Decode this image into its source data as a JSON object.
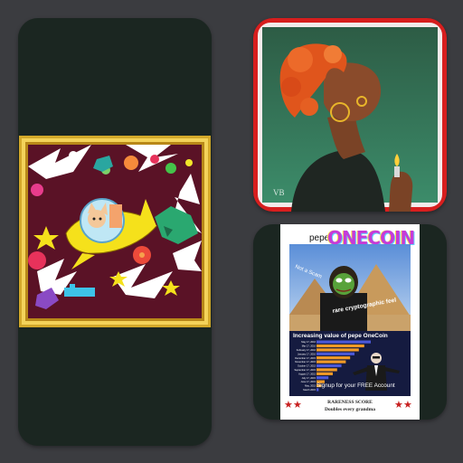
{
  "gallery": {
    "cards": [
      {
        "name": "space-cat-artwork"
      },
      {
        "name": "woman-portrait-artwork"
      },
      {
        "name": "pepe-onecoin-card"
      }
    ]
  },
  "pepe_card": {
    "small_text": "pepe",
    "logo_text": "ONECOIN",
    "photo_caption_1": "Not a Scam",
    "photo_caption_2": "rare cryptographic feel",
    "chart_title": "Increasing value of pepe OneCoin",
    "signup_text": "Signup for your FREE Account",
    "rarity_label": "RARENESS SCORE",
    "rarity_value": "Doubles every grandma",
    "chart_data": {
      "type": "bar",
      "categories": [
        "May 17, 2016",
        "Mar 17, 2016",
        "February 17, 2016",
        "January 17, 2016",
        "December 17, 2015",
        "November 17, 2015",
        "October 17, 2015",
        "September 17, 2015",
        "August 17, 2015",
        "July 17, 2015",
        "June 17, 2015",
        "May, 2015",
        "March 2015"
      ],
      "values": [
        100,
        88,
        78,
        70,
        62,
        54,
        46,
        38,
        30,
        22,
        15,
        9,
        4
      ]
    },
    "colors": {
      "bar": "#f29b26",
      "bar_alt": "#4b58d8",
      "chart_bg": "#151b40",
      "star": "#c81f1f"
    }
  },
  "portrait": {
    "signature": "VB",
    "colors": {
      "frame": "#d71e1e",
      "background": "#2b6e54",
      "hair": "#e0551c"
    }
  },
  "space_art": {
    "colors": {
      "frame": "#d4a92a",
      "background": "#5a1226",
      "ship": "#f5e11b"
    }
  }
}
